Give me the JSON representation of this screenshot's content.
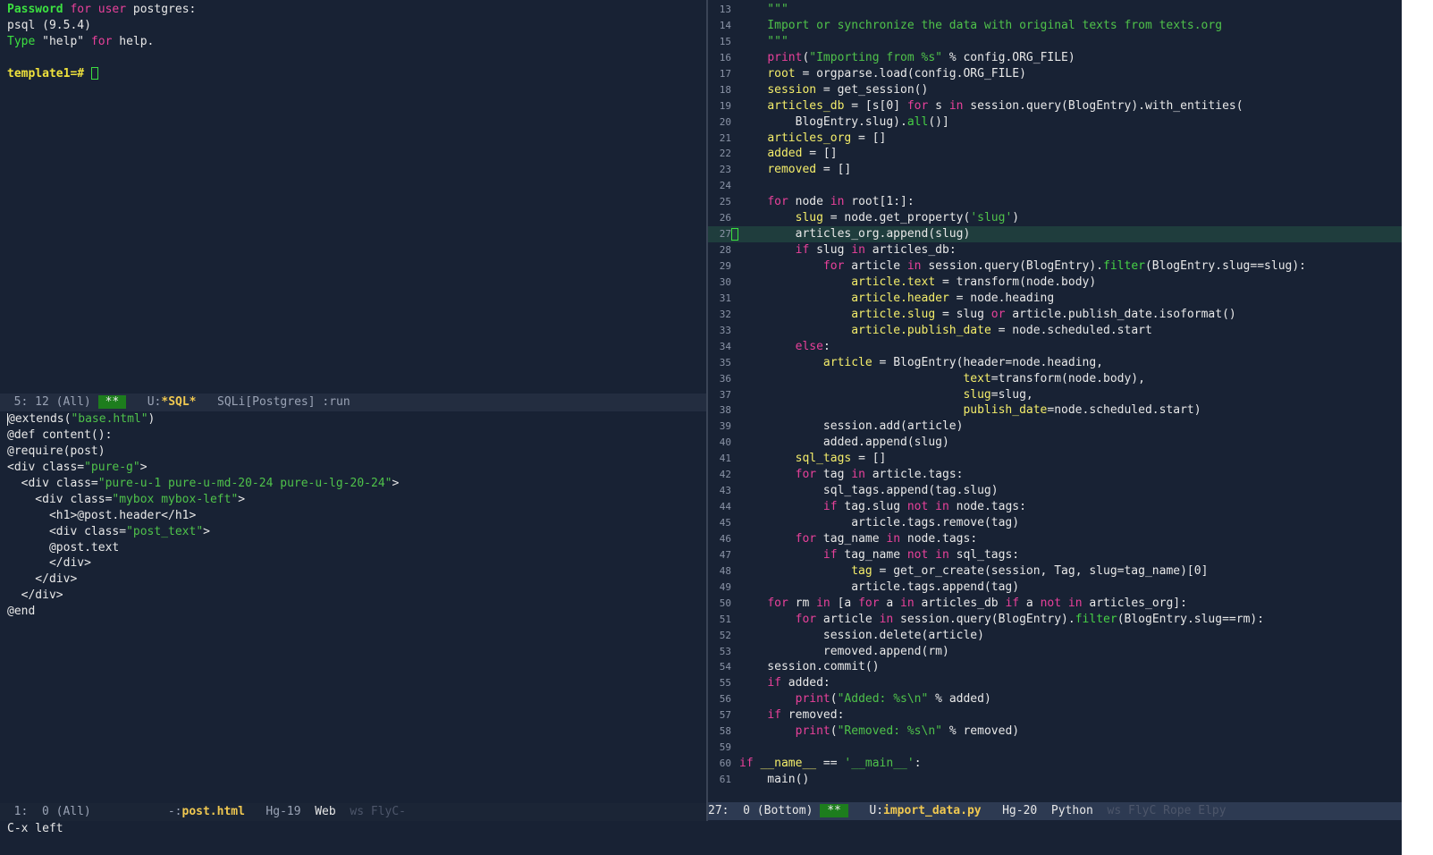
{
  "psql": {
    "line1_label": "Password",
    "line1_for": " for",
    "line1_user": " user",
    "line1_rest": " postgres:",
    "line2": "psql (9.5.4)",
    "line3_type": "Type",
    "line3_help": " \"help\"",
    "line3_for": " for",
    "line3_rest": " help.",
    "prompt": "template1=#"
  },
  "modeline_sql": {
    "position": "  5: 12 (All)",
    "modified": "**",
    "prefix": "   U:",
    "buffer": "*SQL*",
    "mode": "   SQLi[Postgres] :run"
  },
  "html_buffer": {
    "lines": [
      "@extends(\"base.html\")",
      "@def content():",
      "@require(post)",
      "<div class=\"pure-g\">",
      "  <div class=\"pure-u-1 pure-u-md-20-24 pure-u-lg-20-24\">",
      "    <div class=\"mybox mybox-left\">",
      "      <h1>@post.header</h1>",
      "      <div class=\"post_text\">",
      "      @post.text",
      "      </div>",
      "    </div>",
      "  </div>",
      "@end"
    ]
  },
  "modeline_html": {
    "position": "  1:  0 (All)",
    "prefix": "           -:",
    "buffer": "post.html",
    "vc": "   Hg-19",
    "mode": "  Web",
    "minor": "  ws FlyC-"
  },
  "code": {
    "current_line": 27,
    "lines": [
      {
        "n": "13",
        "t": "    \"\"\""
      },
      {
        "n": "14",
        "t": "    Import or synchronize the data with original texts from texts.org"
      },
      {
        "n": "15",
        "t": "    \"\"\""
      },
      {
        "n": "16",
        "t": "    print(\"Importing from %s\" % config.ORG_FILE)"
      },
      {
        "n": "17",
        "t": "    root = orgparse.load(config.ORG_FILE)"
      },
      {
        "n": "18",
        "t": "    session = get_session()"
      },
      {
        "n": "19",
        "t": "    articles_db = [s[0] for s in session.query(BlogEntry).with_entities("
      },
      {
        "n": "20",
        "t": "        BlogEntry.slug).all()]"
      },
      {
        "n": "21",
        "t": "    articles_org = []"
      },
      {
        "n": "22",
        "t": "    added = []"
      },
      {
        "n": "23",
        "t": "    removed = []"
      },
      {
        "n": "24",
        "t": ""
      },
      {
        "n": "25",
        "t": "    for node in root[1:]:"
      },
      {
        "n": "26",
        "t": "        slug = node.get_property('slug')"
      },
      {
        "n": "27",
        "t": "        articles_org.append(slug)"
      },
      {
        "n": "28",
        "t": "        if slug in articles_db:"
      },
      {
        "n": "29",
        "t": "            for article in session.query(BlogEntry).filter(BlogEntry.slug==slug):"
      },
      {
        "n": "30",
        "t": "                article.text = transform(node.body)"
      },
      {
        "n": "31",
        "t": "                article.header = node.heading"
      },
      {
        "n": "32",
        "t": "                article.slug = slug or article.publish_date.isoformat()"
      },
      {
        "n": "33",
        "t": "                article.publish_date = node.scheduled.start"
      },
      {
        "n": "34",
        "t": "        else:"
      },
      {
        "n": "35",
        "t": "            article = BlogEntry(header=node.heading,"
      },
      {
        "n": "36",
        "t": "                                text=transform(node.body),"
      },
      {
        "n": "37",
        "t": "                                slug=slug,"
      },
      {
        "n": "38",
        "t": "                                publish_date=node.scheduled.start)"
      },
      {
        "n": "39",
        "t": "            session.add(article)"
      },
      {
        "n": "40",
        "t": "            added.append(slug)"
      },
      {
        "n": "41",
        "t": "        sql_tags = []"
      },
      {
        "n": "42",
        "t": "        for tag in article.tags:"
      },
      {
        "n": "43",
        "t": "            sql_tags.append(tag.slug)"
      },
      {
        "n": "44",
        "t": "            if tag.slug not in node.tags:"
      },
      {
        "n": "45",
        "t": "                article.tags.remove(tag)"
      },
      {
        "n": "46",
        "t": "        for tag_name in node.tags:"
      },
      {
        "n": "47",
        "t": "            if tag_name not in sql_tags:"
      },
      {
        "n": "48",
        "t": "                tag = get_or_create(session, Tag, slug=tag_name)[0]"
      },
      {
        "n": "49",
        "t": "                article.tags.append(tag)"
      },
      {
        "n": "50",
        "t": "    for rm in [a for a in articles_db if a not in articles_org]:"
      },
      {
        "n": "51",
        "t": "        for article in session.query(BlogEntry).filter(BlogEntry.slug==rm):"
      },
      {
        "n": "52",
        "t": "            session.delete(article)"
      },
      {
        "n": "53",
        "t": "            removed.append(rm)"
      },
      {
        "n": "54",
        "t": "    session.commit()"
      },
      {
        "n": "55",
        "t": "    if added:"
      },
      {
        "n": "56",
        "t": "        print(\"Added: %s\\n\" % added)"
      },
      {
        "n": "57",
        "t": "    if removed:"
      },
      {
        "n": "58",
        "t": "        print(\"Removed: %s\\n\" % removed)"
      },
      {
        "n": "59",
        "t": ""
      },
      {
        "n": "60",
        "t": "if __name__ == '__main__':"
      },
      {
        "n": "61",
        "t": "    main()"
      }
    ]
  },
  "modeline_py": {
    "position": "27:  0 (Bottom)",
    "modified": "**",
    "prefix": "   U:",
    "buffer": "import_data.py",
    "vc": "   Hg-20",
    "mode": "  Python",
    "minor": "  ws FlyC Rope Elpy"
  },
  "minibuffer": "C-x left",
  "colors": {
    "background": "#182234",
    "keyword": "#e8419a",
    "string": "#4fc24a",
    "cursor": "#3ce040"
  }
}
